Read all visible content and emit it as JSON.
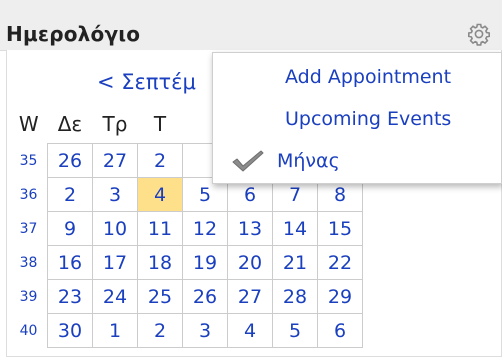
{
  "widget": {
    "title": "Ημερολόγιο",
    "settings_icon": "gear-icon"
  },
  "calendar": {
    "nav_label": "< Σεπτέμ",
    "week_header": "W",
    "day_headers": [
      "Δε",
      "Τρ",
      "Τ",
      "",
      "",
      "",
      ""
    ],
    "weeks": [
      {
        "week": "35",
        "days": [
          "26",
          "27",
          "2",
          "",
          "",
          "",
          ""
        ]
      },
      {
        "week": "36",
        "days": [
          "2",
          "3",
          "4",
          "5",
          "6",
          "7",
          "8"
        ]
      },
      {
        "week": "37",
        "days": [
          "9",
          "10",
          "11",
          "12",
          "13",
          "14",
          "15"
        ]
      },
      {
        "week": "38",
        "days": [
          "16",
          "17",
          "18",
          "19",
          "20",
          "21",
          "22"
        ]
      },
      {
        "week": "39",
        "days": [
          "23",
          "24",
          "25",
          "26",
          "27",
          "28",
          "29"
        ]
      },
      {
        "week": "40",
        "days": [
          "30",
          "1",
          "2",
          "3",
          "4",
          "5",
          "6"
        ]
      }
    ],
    "today": "4",
    "today_color": "#ffe08a",
    "link_color": "#1a3fbf"
  },
  "menu": {
    "items": [
      {
        "label": "Add Appointment",
        "checked": false
      },
      {
        "label": "Upcoming Events",
        "checked": false
      },
      {
        "label": "Μήνας",
        "checked": true,
        "icon": "checkmark-icon"
      }
    ]
  }
}
